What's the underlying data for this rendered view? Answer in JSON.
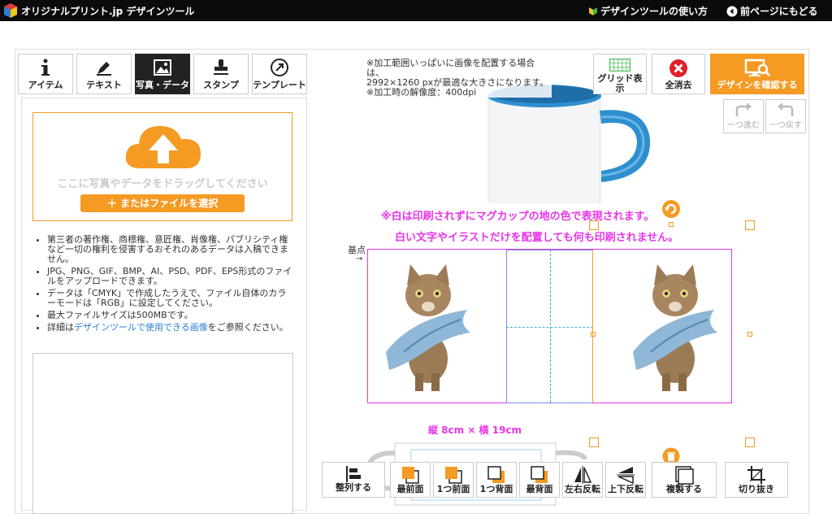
{
  "header": {
    "brand": "オリジナルプリント.jp デザインツール",
    "help_link": "デザインツールの使い方",
    "back_link": "前ページにもどる"
  },
  "tabs": [
    {
      "label": "アイテム",
      "icon": "info-icon"
    },
    {
      "label": "テキスト",
      "icon": "pen-icon"
    },
    {
      "label": "写真・データ",
      "icon": "image-icon",
      "active": true
    },
    {
      "label": "スタンプ",
      "icon": "stamp-icon"
    },
    {
      "label": "テンプレート",
      "icon": "template-icon"
    }
  ],
  "upload": {
    "drop_text": "ここに写真やデータをドラッグしてください",
    "file_button": "＋ またはファイルを選択"
  },
  "notes": {
    "item1": "第三者の著作権、商標権、意匠権、肖像権、パブリシティ権など一切の権利を侵害するおそれのあるデータは入稿できません。",
    "item2": "JPG、PNG、GIF、BMP、AI、PSD、PDF、EPS形式のファイルをアップロードできます。",
    "item3": "データは「CMYK」で作成したうえで、ファイル自体のカラーモードは「RGB」に設定してください。",
    "item4": "最大ファイルサイズは500MBです。",
    "item5_pre": "詳細は",
    "item5_link": "デザインツールで使用できる画像",
    "item5_post": "をご参照ください。"
  },
  "info_text": {
    "line1": "※加工範囲いっぱいに画像を配置する場合は、",
    "line2": "2992×1260 pxが最適な大きさになります。",
    "line3": "※加工時の解像度：400dpi"
  },
  "toolbar": {
    "grid_label": "グリッド表示",
    "clear_label": "全消去",
    "confirm_label": "デザインを確認する",
    "redo_label": "一つ進む",
    "undo_label": "一つ戻す"
  },
  "warnings": {
    "line1": "※白は印刷されずにマグカップの地の色で表現されます。",
    "line2": "白い文字やイラストだけを配置しても何も印刷されません。"
  },
  "canvas": {
    "base_point": "基点",
    "size_label": "縦 8cm × 横 19cm"
  },
  "bottom_toolbar": {
    "align": "整列する",
    "front": "最前面",
    "forward": "1つ前面",
    "backward": "1つ背面",
    "back": "最背面",
    "flip_h": "左右反転",
    "flip_v": "上下反転",
    "duplicate": "複製する",
    "crop": "切り抜き"
  },
  "colors": {
    "accent": "#f59a23",
    "guide": "#e934e9",
    "header_bg": "#0b0b0b",
    "clear_red": "#e0202a",
    "mug_blue": "#2e8fcf"
  }
}
